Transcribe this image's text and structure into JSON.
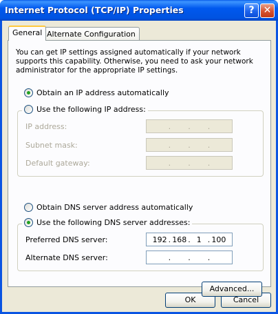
{
  "window": {
    "title": "Internet Protocol (TCP/IP) Properties",
    "help_label": "?",
    "close_label": "✕"
  },
  "tabs": [
    {
      "label": "General",
      "selected": true
    },
    {
      "label": "Alternate Configuration",
      "selected": false
    }
  ],
  "intro_text": "You can get IP settings assigned automatically if your network supports this capability. Otherwise, you need to ask your network administrator for the appropriate IP settings.",
  "ip_mode": {
    "auto_label": "Obtain an IP address automatically",
    "manual_label": "Use the following IP address:",
    "selected": "auto"
  },
  "ip_fields": [
    {
      "label": "IP address:",
      "octets": [
        "",
        "",
        "",
        ""
      ],
      "enabled": false
    },
    {
      "label": "Subnet mask:",
      "octets": [
        "",
        "",
        "",
        ""
      ],
      "enabled": false
    },
    {
      "label": "Default gateway:",
      "octets": [
        "",
        "",
        "",
        ""
      ],
      "enabled": false
    }
  ],
  "dns_mode": {
    "auto_label": "Obtain DNS server address automatically",
    "manual_label": "Use the following DNS server addresses:",
    "selected": "manual"
  },
  "dns_fields": [
    {
      "label": "Preferred DNS server:",
      "octets": [
        "192",
        "168",
        "1",
        "100"
      ],
      "enabled": true
    },
    {
      "label": "Alternate DNS server:",
      "octets": [
        "",
        "",
        "",
        ""
      ],
      "enabled": true
    }
  ],
  "buttons": {
    "advanced": "Advanced...",
    "ok": "OK",
    "cancel": "Cancel"
  },
  "colors": {
    "titlebar": "#0054E3",
    "face": "#ECE9D8",
    "tab_highlight": "#FFC83C",
    "radio_dot": "#21A121"
  }
}
